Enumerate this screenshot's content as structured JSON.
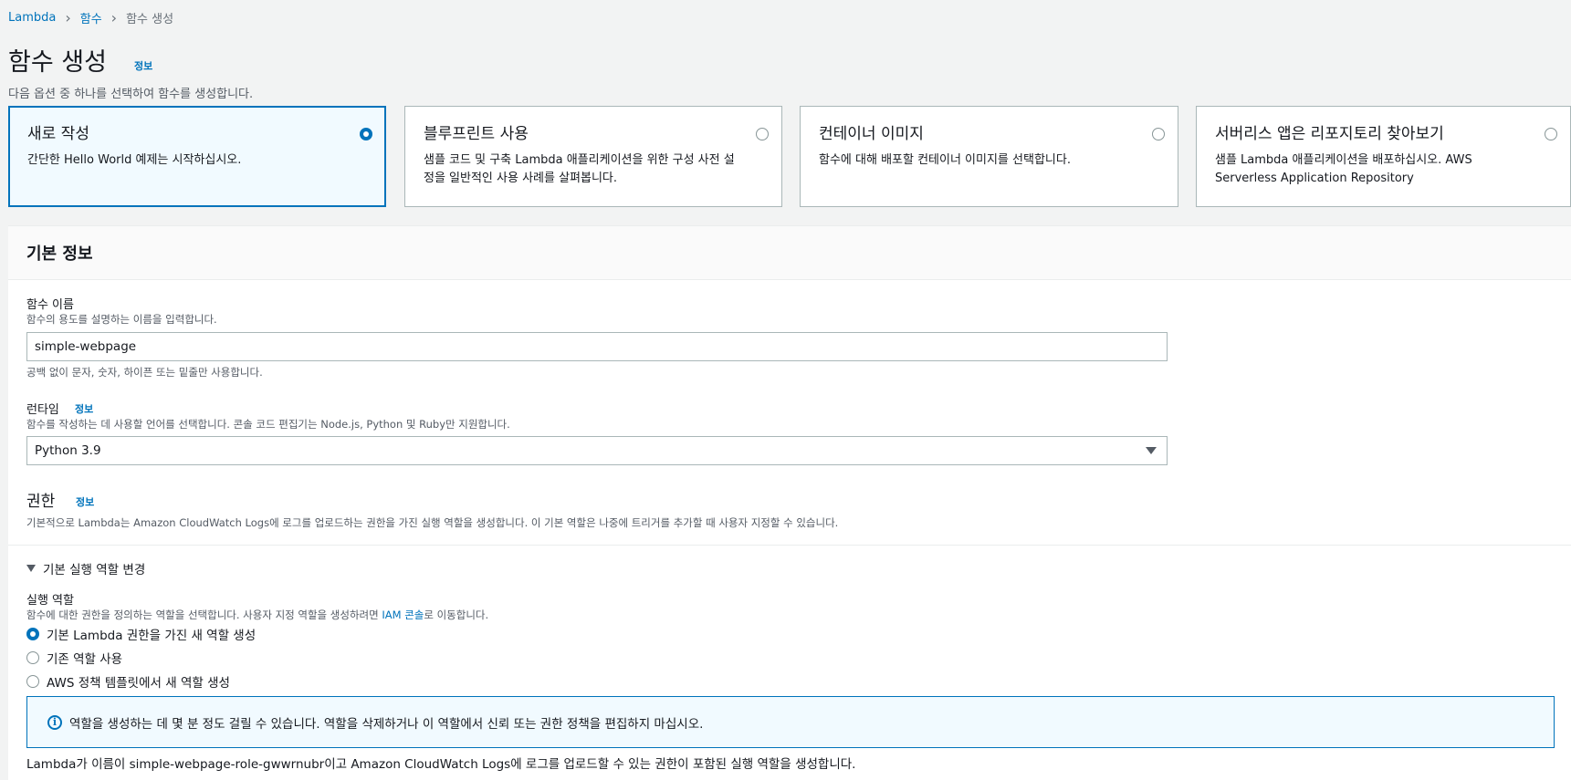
{
  "breadcrumb": [
    "Lambda",
    "함수",
    "함수 생성"
  ],
  "page": {
    "title": "함수 생성",
    "info_link": "정보",
    "description": "다음 옵션 중 하나를 선택하여 함수를 생성합니다."
  },
  "options": [
    {
      "title": "새로 작성",
      "desc": "간단한 Hello World 예제는 시작하십시오.",
      "selected": true
    },
    {
      "title": "블루프린트 사용",
      "desc": "샘플 코드 및 구축 Lambda 애플리케이션을 위한 구성 사전 설정을 일반적인 사용 사례를 살펴봅니다.",
      "selected": false
    },
    {
      "title": "컨테이너 이미지",
      "desc": "함수에 대해 배포할 컨테이너 이미지를 선택합니다.",
      "selected": false
    },
    {
      "title": "서버리스 앱은 리포지토리 찾아보기",
      "desc": "샘플 Lambda 애플리케이션을 배포하십시오. AWS Serverless Application Repository",
      "selected": false
    }
  ],
  "basic_info": {
    "title": "기본 정보",
    "function_name": {
      "label": "함수 이름",
      "hint": "함수의 용도를 설명하는 이름을 입력합니다.",
      "value": "simple-webpage",
      "constraint": "공백 없이 문자, 숫자, 하이픈 또는 밑줄만 사용합니다."
    },
    "runtime": {
      "label": "런타임",
      "info_link": "정보",
      "hint": "함수를 작성하는 데 사용할 언어를 선택합니다. 콘솔 코드 편집기는 Node.js, Python 및 Ruby만 지원합니다.",
      "value": "Python 3.9"
    },
    "permissions": {
      "title": "권한",
      "info_link": "정보",
      "desc": "기본적으로 Lambda는 Amazon CloudWatch Logs에 로그를 업로드하는 권한을 가진 실행 역할을 생성합니다. 이 기본 역할은 나중에 트리거를 추가할 때 사용자 지정할 수 있습니다."
    },
    "exec_role": {
      "expander_label": "기본 실행 역할 변경",
      "label": "실행 역할",
      "hint_prefix": "함수에 대한 권한을 정의하는 역할을 선택합니다. 사용자 지정 역할을 생성하려면 ",
      "hint_link": "IAM 콘솔",
      "hint_suffix": "로 이동합니다.",
      "options": [
        {
          "label": "기본 Lambda 권한을 가진 새 역할 생성",
          "selected": true
        },
        {
          "label": "기존 역할 사용",
          "selected": false
        },
        {
          "label": "AWS 정책 템플릿에서 새 역할 생성",
          "selected": false
        }
      ],
      "alert": "역할을 생성하는 데 몇 분 정도 걸릴 수 있습니다. 역할을 삭제하거나 이 역할에서 신뢰 또는 권한 정책을 편집하지 마십시오.",
      "footer": "Lambda가 이름이 simple-webpage-role-gwwrnubr이고 Amazon CloudWatch Logs에 로그를 업로드할 수 있는 권한이 포함된 실행 역할을 생성합니다."
    }
  }
}
